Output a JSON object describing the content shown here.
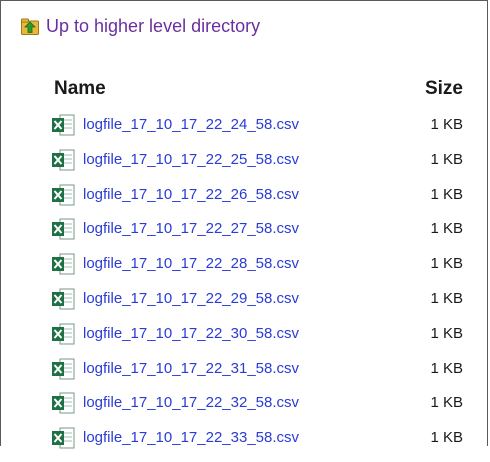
{
  "parent_link": {
    "label": "Up to higher level directory",
    "icon": "folder-up-icon"
  },
  "columns": {
    "name": "Name",
    "size": "Size"
  },
  "files": [
    {
      "name": "logfile_17_10_17_22_24_58.csv",
      "size": "1 KB"
    },
    {
      "name": "logfile_17_10_17_22_25_58.csv",
      "size": "1 KB"
    },
    {
      "name": "logfile_17_10_17_22_26_58.csv",
      "size": "1 KB"
    },
    {
      "name": "logfile_17_10_17_22_27_58.csv",
      "size": "1 KB"
    },
    {
      "name": "logfile_17_10_17_22_28_58.csv",
      "size": "1 KB"
    },
    {
      "name": "logfile_17_10_17_22_29_58.csv",
      "size": "1 KB"
    },
    {
      "name": "logfile_17_10_17_22_30_58.csv",
      "size": "1 KB"
    },
    {
      "name": "logfile_17_10_17_22_31_58.csv",
      "size": "1 KB"
    },
    {
      "name": "logfile_17_10_17_22_32_58.csv",
      "size": "1 KB"
    },
    {
      "name": "logfile_17_10_17_22_33_58.csv",
      "size": "1 KB"
    }
  ],
  "colors": {
    "parent_link": "#6b2fa0",
    "file_link": "#2a3bd6",
    "excel_green": "#1e7145"
  }
}
